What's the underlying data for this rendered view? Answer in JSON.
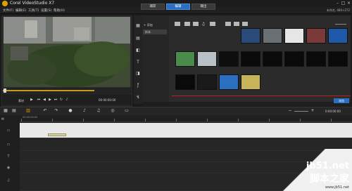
{
  "app": {
    "title": "Corel VideoStudio X7",
    "project_info": "未命名, 480×272"
  },
  "menubar": {
    "items": [
      "文件(F)",
      "编辑(E)",
      "工具(T)",
      "设置(S)",
      "帮助(H)"
    ]
  },
  "steps": [
    "捕获",
    "编辑",
    "输出"
  ],
  "preview": {
    "mode_label": "素材",
    "timecode": "00:00:00:00",
    "buttons": [
      "play-icon",
      "home-icon",
      "prev-icon",
      "next-icon",
      "end-icon",
      "repeat-icon",
      "volume-icon"
    ],
    "playhead_fraction": 0.01
  },
  "library": {
    "add_label": "添加",
    "folder": "样本",
    "browse_label": "浏览",
    "thumbnails": [
      {
        "label": "",
        "color": "#2a4a7a"
      },
      {
        "label": "",
        "color": "#6a6f73"
      },
      {
        "label": "",
        "color": "#e6e6e6"
      },
      {
        "label": "",
        "color": "#7a3a3a"
      },
      {
        "label": "",
        "color": "#1e5aa8"
      },
      {
        "label": "",
        "color": "#4a8a4a"
      },
      {
        "label": "",
        "color": "#b8c0c8"
      },
      {
        "label": "",
        "color": "#0e0e0e"
      },
      {
        "label": "",
        "color": "#0a0a0a"
      },
      {
        "label": "",
        "color": "#0a0a0a"
      },
      {
        "label": "",
        "color": "#0a0a0a"
      },
      {
        "label": "",
        "color": "#0a0a0a"
      },
      {
        "label": "",
        "color": "#0a0a0a"
      },
      {
        "label": "",
        "color": "#0a0a0a"
      },
      {
        "label": "",
        "color": "#1a1a1a"
      },
      {
        "label": "",
        "color": "#2a6fc0"
      },
      {
        "label": "",
        "color": "#c9b35a"
      }
    ]
  },
  "timeline": {
    "ruler_labels": [
      "00:00:00:00",
      "",
      "",
      "",
      "",
      "",
      "",
      "",
      "",
      "",
      ""
    ],
    "zoom_display": "0:00:00:00"
  },
  "watermark": {
    "site": "jb51.net",
    "cn": "脚本之家",
    "url": "www.jb51.net"
  },
  "colors": {
    "accent": "#2a6fc0",
    "playhead": "#c79a1a",
    "bg": "#1b1b1b"
  }
}
